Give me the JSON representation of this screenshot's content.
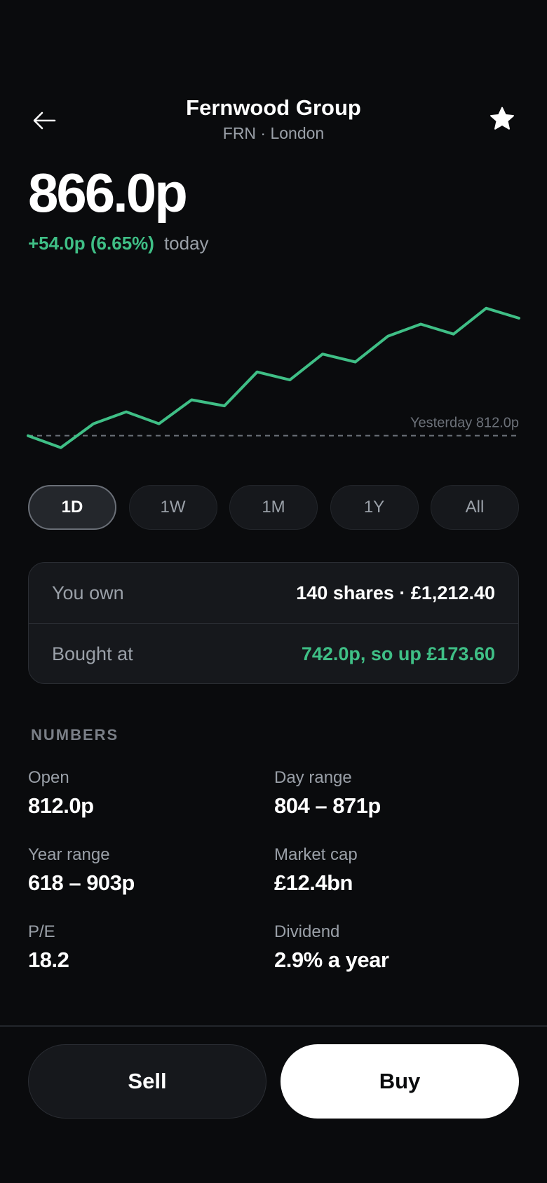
{
  "header": {
    "title": "Fernwood Group",
    "subtitle": "FRN · London"
  },
  "quote": {
    "price": "866.0p",
    "change": "+54.0p (6.65%)",
    "change_period": "today"
  },
  "colors": {
    "accent_up": "#3fbf86",
    "background": "#0a0b0d"
  },
  "chart_data": {
    "type": "line",
    "reference_label": "Yesterday 812.0p",
    "reference_value": 812.0,
    "ylim": [
      795,
      890
    ],
    "grid": false,
    "series": [
      {
        "values": [
          812,
          806,
          818,
          824,
          818,
          830,
          827,
          844,
          840,
          853,
          849,
          862,
          868,
          863,
          876,
          871
        ]
      }
    ]
  },
  "ranges": [
    "1D",
    "1W",
    "1M",
    "1Y",
    "All"
  ],
  "selected_range": "1D",
  "holding": {
    "own_label": "You own",
    "own_value": "140 shares · £1,212.40",
    "bought_label": "Bought at",
    "bought_value": "742.0p, so up £173.60"
  },
  "numbers": {
    "title": "NUMBERS",
    "stats": [
      {
        "label": "Open",
        "value": "812.0p"
      },
      {
        "label": "Day range",
        "value": "804 – 871p"
      },
      {
        "label": "Year range",
        "value": "618 – 903p"
      },
      {
        "label": "Market cap",
        "value": "£12.4bn"
      },
      {
        "label": "P/E",
        "value": "18.2"
      },
      {
        "label": "Dividend",
        "value": "2.9% a year"
      }
    ]
  },
  "actions": {
    "sell": "Sell",
    "buy": "Buy"
  },
  "icons": {
    "back": "back-arrow-icon",
    "favorite": "star-icon"
  }
}
